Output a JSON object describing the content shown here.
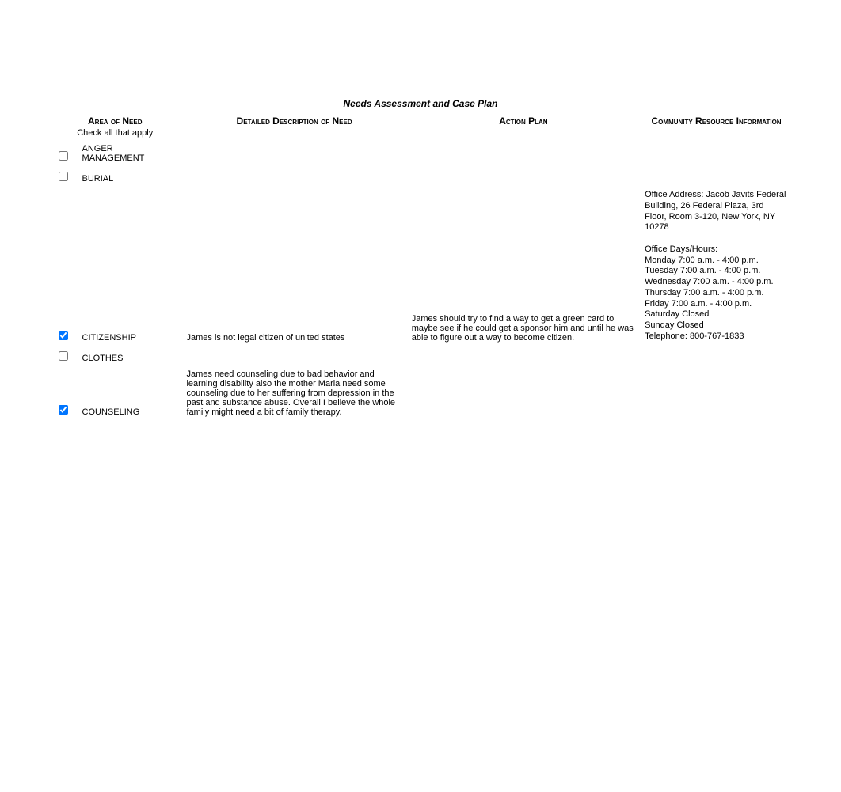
{
  "title": "Needs Assessment and Case Plan",
  "headers": {
    "area": "Area of Need",
    "area_sub": "Check all that apply",
    "desc": "Detailed Description of Need",
    "plan": "Action Plan",
    "resource": "Community Resource Information"
  },
  "rows": [
    {
      "checked": false,
      "area": "ANGER MANAGEMENT",
      "desc": "",
      "plan": "",
      "resource": ""
    },
    {
      "checked": false,
      "area": "BURIAL",
      "desc": "",
      "plan": "",
      "resource": ""
    },
    {
      "checked": true,
      "area": "CITIZENSHIP",
      "desc": "James is not legal citizen of united states",
      "plan": "James should try to find a way to get a green card to maybe see if he could get a sponsor him and until he was able to figure out a way to become citizen.",
      "resource": "Office Address: Jacob Javits Federal Building, 26 Federal Plaza, 3rd Floor, Room 3-120, New York, NY 10278\n\nOffice Days/Hours:\nMonday   7:00 a.m. - 4:00 p.m.\nTuesday  7:00 a.m. - 4:00 p.m.\nWednesday           7:00 a.m. - 4:00 p.m.\nThursday 7:00 a.m. - 4:00 p.m.\nFriday      7:00 a.m. - 4:00 p.m.\nSaturday  Closed\nSunday    Closed\nTelephone: 800-767-1833"
    },
    {
      "checked": false,
      "area": "CLOTHES",
      "desc": "",
      "plan": "",
      "resource": ""
    },
    {
      "checked": true,
      "area": "COUNSELING",
      "desc": " James need counseling due to bad behavior and learning disability also the mother Maria need some counseling due to her suffering from depression in the past and substance abuse. Overall I believe the whole family might need a bit of family therapy.",
      "plan": "",
      "resource": ""
    }
  ]
}
